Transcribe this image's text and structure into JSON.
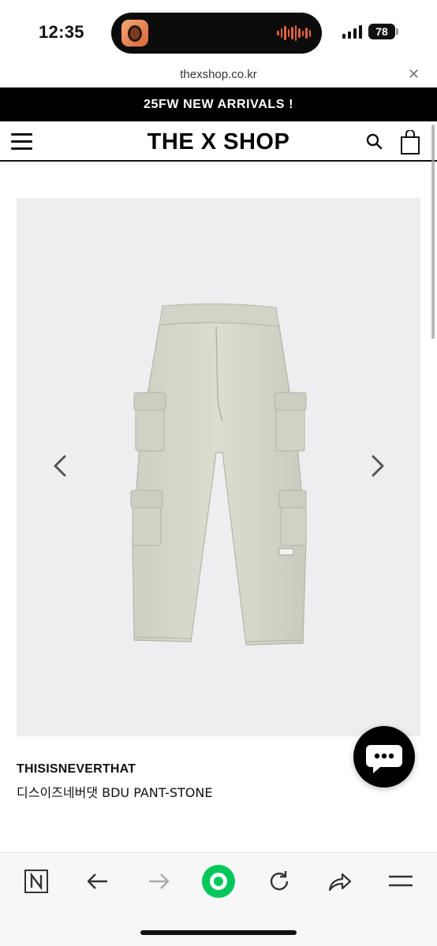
{
  "status_bar": {
    "time": "12:35",
    "battery": "78"
  },
  "browser": {
    "url": "thexshop.co.kr",
    "close_icon": "close-icon"
  },
  "site": {
    "announcement": "25FW NEW ARRIVALS !",
    "logo": "THE X SHOP",
    "menu_icon": "hamburger-menu-icon",
    "search_icon": "search-icon",
    "cart_icon": "shopping-bag-icon"
  },
  "product": {
    "brand": "THISISNEVERTHAT",
    "name": "디스이즈네버댓 BDU PANT-STONE",
    "image_icon": "cargo-pants-image",
    "prev_icon": "chevron-left-icon",
    "next_icon": "chevron-right-icon",
    "image_bg": "#eeeef0",
    "garment_color": "#d8d8cc"
  },
  "chat": {
    "icon": "chat-bubble-icon"
  },
  "toolbar": {
    "items": [
      {
        "icon": "naver-n-icon"
      },
      {
        "icon": "back-arrow-icon"
      },
      {
        "icon": "forward-arrow-icon"
      },
      {
        "icon": "green-circle-icon"
      },
      {
        "icon": "reload-icon"
      },
      {
        "icon": "share-icon"
      },
      {
        "icon": "menu-icon"
      }
    ],
    "accent": "#03c75a"
  }
}
